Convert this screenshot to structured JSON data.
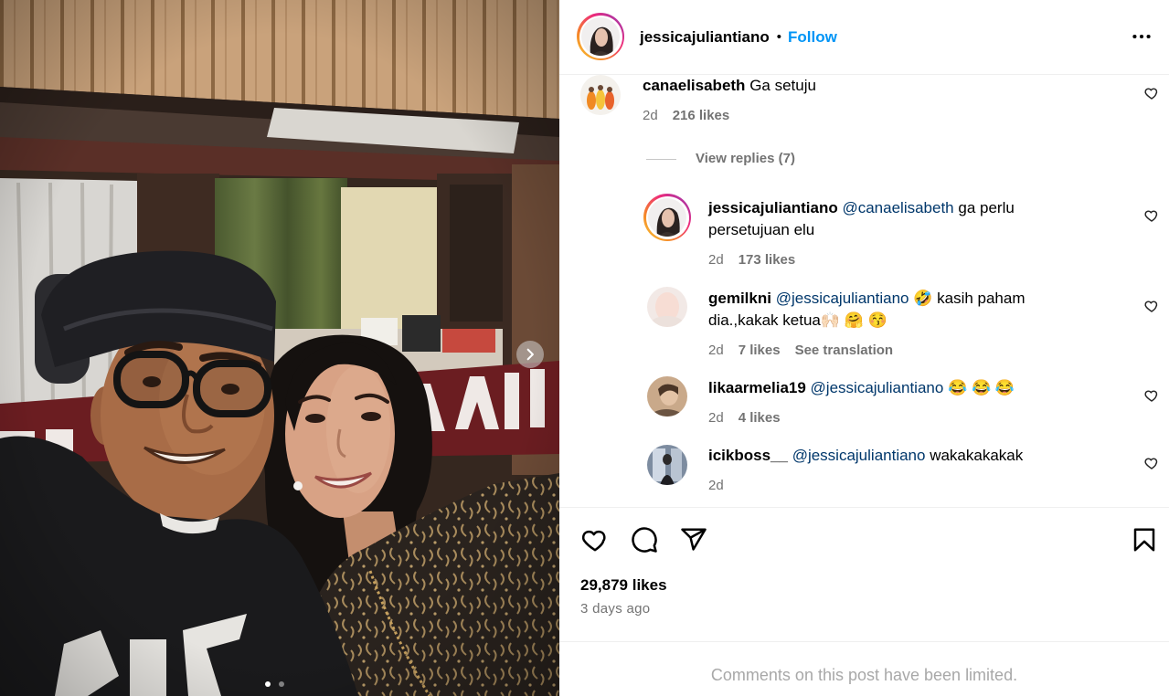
{
  "theme": {
    "accent": "#0095f6",
    "mention": "#00376b",
    "muted": "#737373",
    "text": "#000000",
    "notice": "#a8a8a8"
  },
  "post": {
    "author": {
      "username": "jessicajuliantiano",
      "separator": "•",
      "follow_label": "Follow"
    },
    "more_icon": "more-options-icon",
    "carousel": {
      "current": 1,
      "count": 2,
      "next_icon": "chevron-right-icon"
    },
    "comments": [
      {
        "username": "canaelisabeth",
        "text": "Ga setuju",
        "time": "2d",
        "likes": "216 likes"
      }
    ],
    "view_replies_label": "View replies (7)",
    "replies": [
      {
        "username": "jessicajuliantiano",
        "mention": "@canaelisabeth",
        "text": "ga perlu persetujuan elu",
        "time": "2d",
        "likes": "173 likes"
      },
      {
        "username": "gemilkni",
        "mention": "@jessicajuliantiano",
        "text": "🤣 kasih paham dia.,kakak ketua🙌🏻 🤗 😚",
        "time": "2d",
        "likes": "7 likes",
        "translate_label": "See translation"
      },
      {
        "username": "likaarmelia19",
        "mention": "@jessicajuliantiano",
        "text": "😂 😂 😂",
        "time": "2d",
        "likes": "4 likes"
      },
      {
        "username": "icikboss__",
        "mention": "@jessicajuliantiano",
        "text": "wakakakakak",
        "time": "2d"
      }
    ],
    "actions": {
      "like_icon": "heart-outline-icon",
      "comment_icon": "comment-bubble-icon",
      "share_icon": "paper-plane-icon",
      "save_icon": "bookmark-icon",
      "comment_like_icon": "heart-outline-icon"
    },
    "likes_label": "29,879 likes",
    "time_ago": "3 days ago",
    "limited_notice": "Comments on this post have been limited."
  }
}
